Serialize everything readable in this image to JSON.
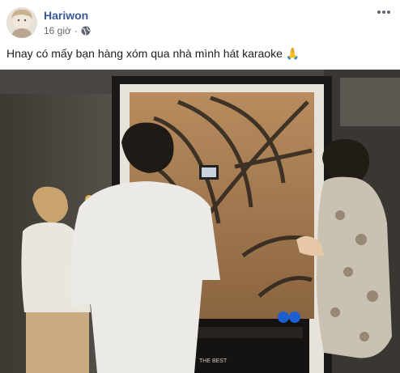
{
  "post": {
    "author": "Hariwon",
    "time": "16 giờ",
    "separator": "·",
    "audience_icon": "globe-icon",
    "more_icon": "more-horizontal-icon",
    "message": "Hnay có mấy bạn hàng xóm qua nhà mình hát karaoke",
    "message_emoji": "🙏",
    "photo_sign_text": "THE BEST"
  },
  "colors": {
    "author_link": "#385898",
    "meta_text": "#616770",
    "body_text": "#1c1e21"
  }
}
